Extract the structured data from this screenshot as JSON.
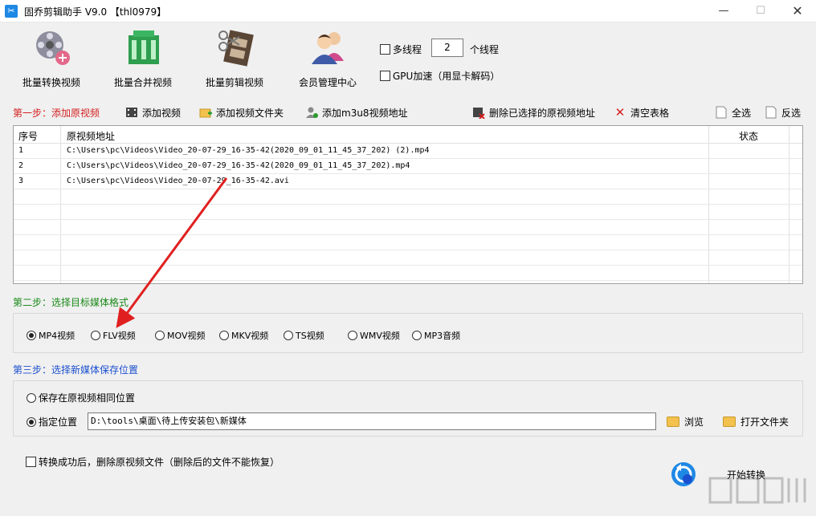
{
  "window": {
    "title": "固乔剪辑助手 V9.0 【thl0979】",
    "min_label": "—",
    "max_label": "☐",
    "close_label": "✕"
  },
  "toolbar": {
    "batch_convert": "批量转换视频",
    "batch_merge": "批量合并视频",
    "batch_cut": "批量剪辑视频",
    "member_center": "会员管理中心"
  },
  "options": {
    "multithread_label": "多线程",
    "thread_count": "2",
    "thread_unit": "个线程",
    "gpu_label": "GPU加速（用显卡解码）"
  },
  "step1": {
    "title": "第一步：添加原视频",
    "add_video": "添加视频",
    "add_folder": "添加视频文件夹",
    "add_m3u8": "添加m3u8视频地址",
    "delete_selected": "删除已选择的原视频地址",
    "clear_table": "清空表格",
    "select_all": "全选",
    "invert": "反选"
  },
  "table": {
    "headers": [
      "序号",
      "原视频地址",
      "状态"
    ],
    "rows": [
      {
        "index": "1",
        "path": "C:\\Users\\pc\\Videos\\Video_20-07-29_16-35-42(2020_09_01_11_45_37_202) (2).mp4",
        "status": ""
      },
      {
        "index": "2",
        "path": "C:\\Users\\pc\\Videos\\Video_20-07-29_16-35-42(2020_09_01_11_45_37_202).mp4",
        "status": ""
      },
      {
        "index": "3",
        "path": "C:\\Users\\pc\\Videos\\Video_20-07-29_16-35-42.avi",
        "status": ""
      }
    ]
  },
  "step2": {
    "title": "第二步：选择目标媒体格式",
    "formats": [
      "MP4视频",
      "FLV视频",
      "MOV视频",
      "MKV视频",
      "TS视频",
      "WMV视频",
      "MP3音频"
    ],
    "selected": "MP4视频"
  },
  "step3": {
    "title": "第三步：选择新媒体保存位置",
    "same_location": "保存在原视频相同位置",
    "specify_location": "指定位置",
    "path": "D:\\tools\\桌面\\待上传安装包\\新媒体",
    "browse": "浏览",
    "open_folder": "打开文件夹"
  },
  "bottom": {
    "delete_after": "转换成功后，删除原视频文件（删除后的文件不能恢复）",
    "start": "开始转换"
  },
  "colors": {
    "step1": "#d42020",
    "step2": "#1a8a1a",
    "step3": "#1a4fcf",
    "arrow": "#e02020"
  }
}
